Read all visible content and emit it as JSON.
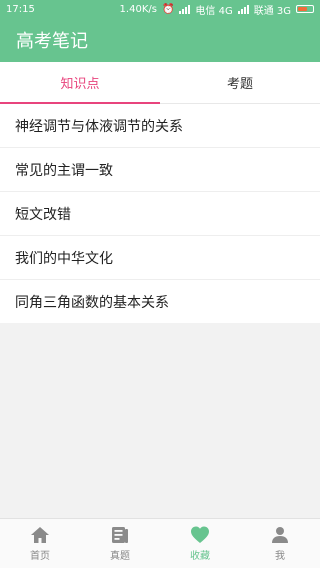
{
  "status": {
    "time": "17:15",
    "speed": "1.40K/s",
    "carrier1": "电信 4G",
    "carrier2": "联通 3G"
  },
  "app": {
    "title": "高考笔记"
  },
  "tabs": [
    {
      "label": "知识点",
      "active": true
    },
    {
      "label": "考题",
      "active": false
    }
  ],
  "list": [
    "神经调节与体液调节的关系",
    "常见的主谓一致",
    "短文改错",
    "我们的中华文化",
    "同角三角函数的基本关系"
  ],
  "bottom_nav": [
    {
      "label": "首页",
      "icon": "home-icon"
    },
    {
      "label": "真题",
      "icon": "book-icon"
    },
    {
      "label": "收藏",
      "icon": "heart-icon",
      "active": true
    },
    {
      "label": "我",
      "icon": "person-icon"
    }
  ],
  "colors": {
    "primary": "#67c48f",
    "accent": "#e8447d"
  }
}
